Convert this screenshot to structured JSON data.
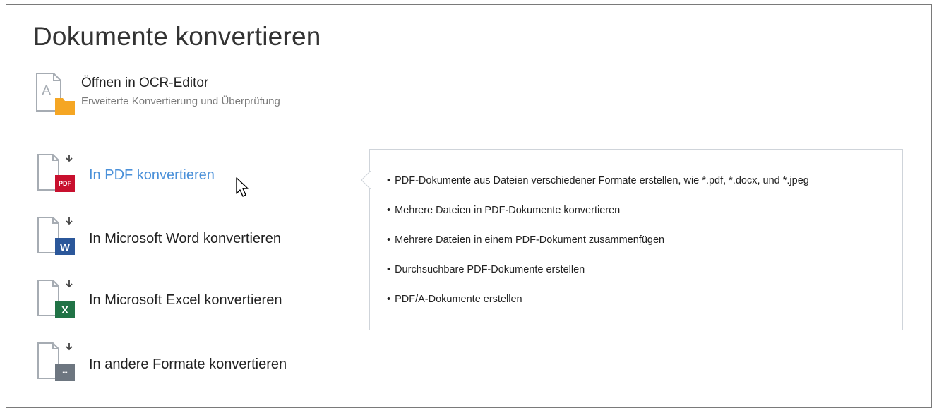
{
  "page": {
    "title": "Dokumente konvertieren"
  },
  "ocr_editor": {
    "title": "Öffnen in OCR-Editor",
    "subtitle": "Erweiterte Konvertierung und Überprüfung",
    "icon": "ocr-editor-icon"
  },
  "convert_items": [
    {
      "label": "In PDF konvertieren",
      "badge": "PDF",
      "badge_color": "#c8102e",
      "icon": "pdf-file-icon",
      "active": true
    },
    {
      "label": "In Microsoft Word konvertieren",
      "badge": "W",
      "badge_color": "#2b579a",
      "icon": "word-file-icon",
      "active": false
    },
    {
      "label": "In Microsoft Excel konvertieren",
      "badge": "X",
      "badge_color": "#217346",
      "icon": "excel-file-icon",
      "active": false
    },
    {
      "label": "In andere Formate konvertieren",
      "badge": "...",
      "badge_color": "#6d7680",
      "icon": "other-formats-file-icon",
      "active": false
    }
  ],
  "tooltip": {
    "items": [
      "PDF-Dokumente aus Dateien verschiedener Formate erstellen, wie *.pdf, *.docx, und *.jpeg",
      "Mehrere Dateien in PDF-Dokumente konvertieren",
      "Mehrere Dateien in einem PDF-Dokument zusammenfügen",
      "Durchsuchbare PDF-Dokumente erstellen",
      "PDF/A-Dokumente erstellen"
    ]
  },
  "colors": {
    "accent_link": "#4a90d9",
    "folder_orange": "#f5a623",
    "icon_gray": "#a6acb3"
  }
}
